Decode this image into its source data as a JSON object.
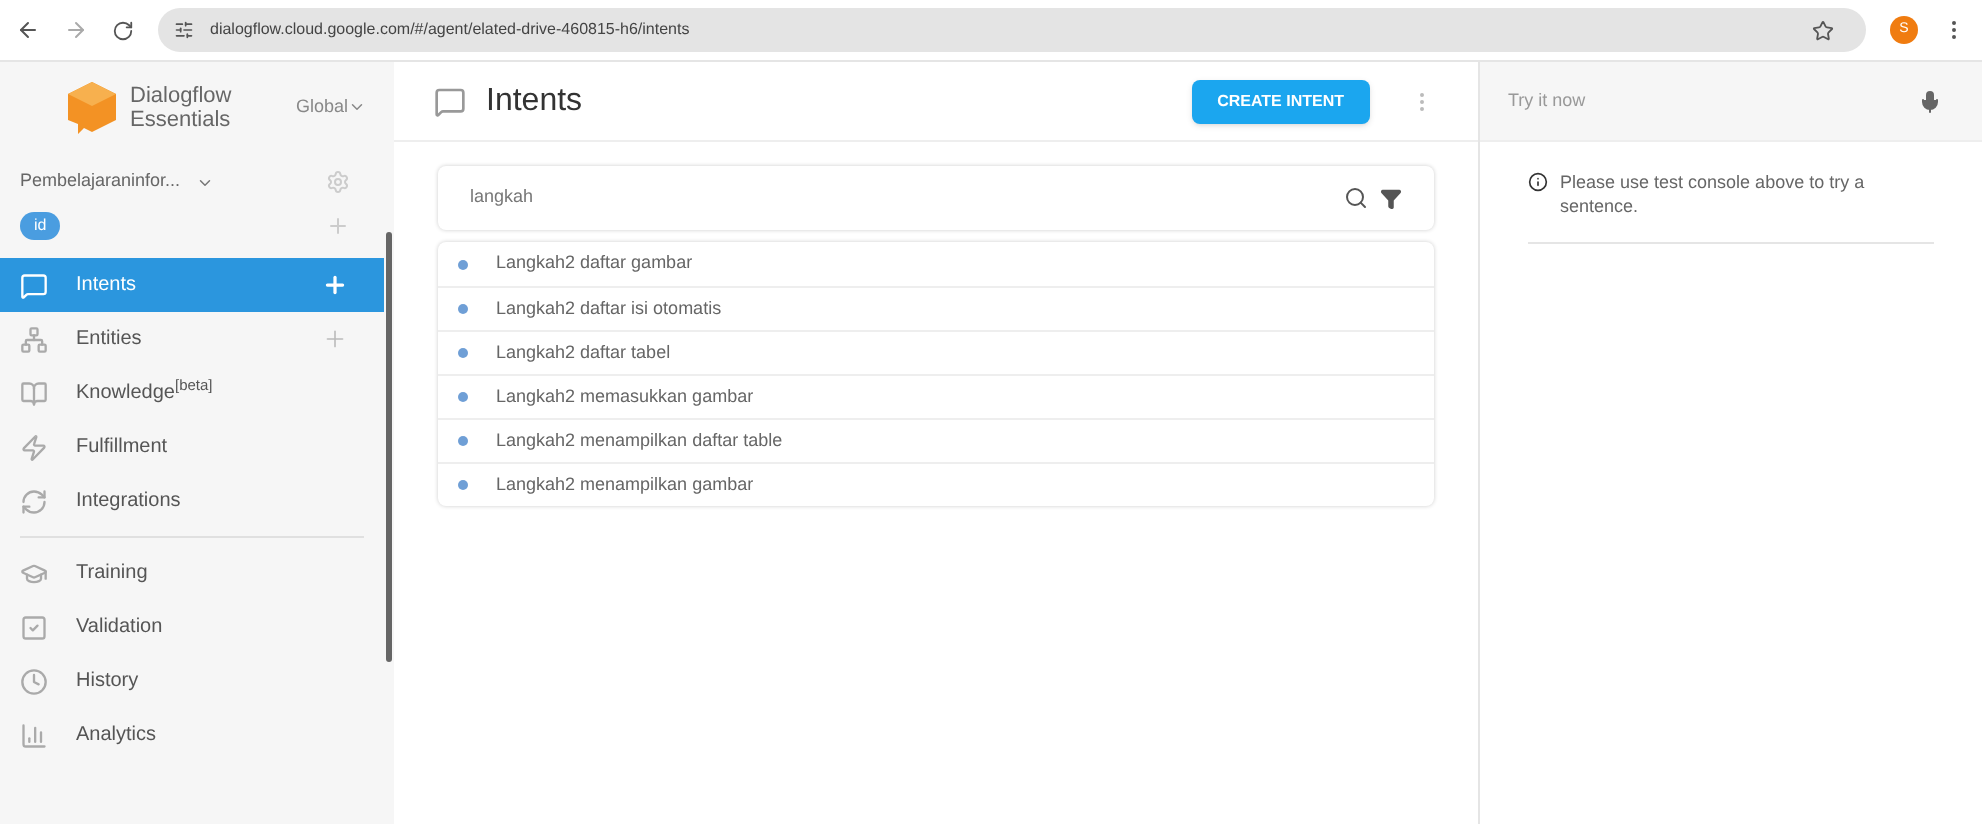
{
  "browser": {
    "url": "dialogflow.cloud.google.com/#/agent/elated-drive-460815-h6/intents",
    "profile": "S"
  },
  "sidebar": {
    "brand": [
      "Dialogflow",
      "Essentials"
    ],
    "region": "Global",
    "agent": "Pembelajaraninfor...",
    "language": "id",
    "items": [
      {
        "label": "Intents",
        "selected": true,
        "add": true
      },
      {
        "label": "Entities",
        "selected": false,
        "add": true
      },
      {
        "label": "Knowledge$^{[beta]}$",
        "selected": false,
        "add": false
      },
      {
        "label": "Fulfillment",
        "selected": false,
        "add": false
      },
      {
        "label": "Integrations",
        "selected": false,
        "add": false
      },
      {
        "label": "Training",
        "selected": false,
        "add": false
      },
      {
        "label": "Validation",
        "selected": false,
        "add": false
      },
      {
        "label": "History",
        "selected": false,
        "add": false
      },
      {
        "label": "Analytics",
        "selected": false,
        "add": false
      }
    ]
  },
  "main": {
    "title": "Intents",
    "create_button": "CREATE INTENT",
    "search": {
      "value": "langkah"
    },
    "intents": [
      {
        "name": "Langkah2 daftar gambar"
      },
      {
        "name": "Langkah2 daftar isi otomatis"
      },
      {
        "name": "Langkah2 daftar tabel"
      },
      {
        "name": "Langkah2 memasukkan gambar"
      },
      {
        "name": "Langkah2 menampilkan daftar table"
      },
      {
        "name": "Langkah2 menampilkan gambar"
      }
    ]
  },
  "console": {
    "placeholder": "Try it now",
    "message": "Please use test console above to try a sentence."
  }
}
